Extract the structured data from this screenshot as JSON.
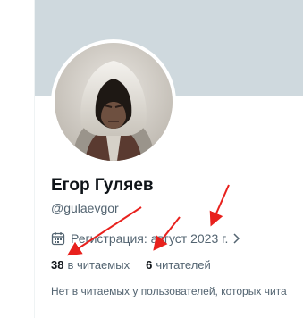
{
  "profile": {
    "display_name": "Егор Гуляев",
    "handle": "@gulaevgor",
    "joined": "Регистрация: август 2023 г.",
    "following_count": "38",
    "following_label": "в читаемых",
    "followers_count": "6",
    "followers_label": "читателей",
    "notice": "Нет в читаемых у пользователей, которых чита"
  },
  "colors": {
    "banner": "#cfd9de",
    "primary_text": "#0f1419",
    "secondary_text": "#536471",
    "annotation_arrow": "#e8211d"
  },
  "icons": {
    "joined": "calendar-icon",
    "joined_more": "chevron-right-icon"
  }
}
